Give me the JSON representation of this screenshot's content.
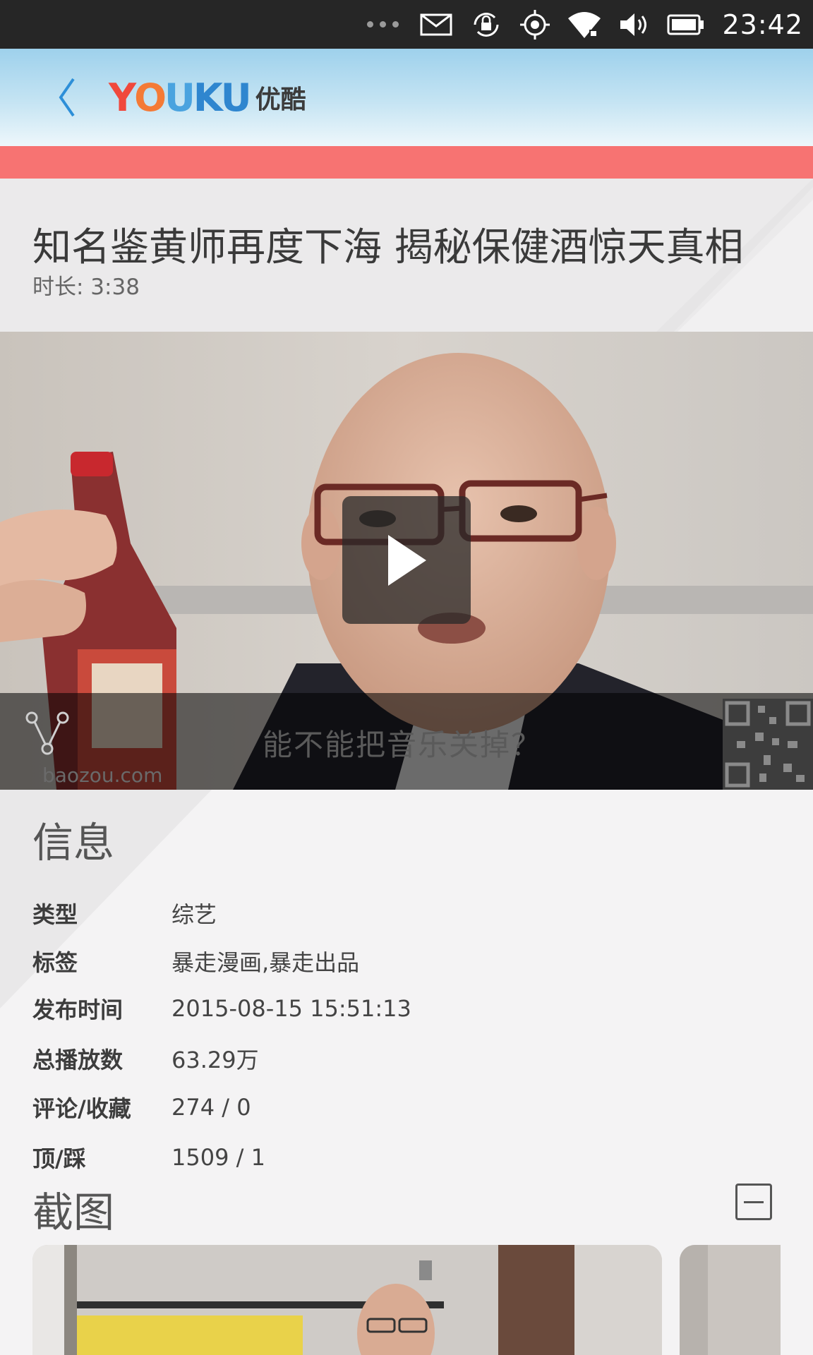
{
  "status_bar": {
    "time": "23:42",
    "icons": [
      "more-dots-icon",
      "mail-icon",
      "rotation-lock-icon",
      "location-icon",
      "wifi-icon",
      "volume-icon",
      "battery-icon"
    ]
  },
  "header": {
    "logo_en": "YOUKU",
    "logo_cn": "优酷"
  },
  "video": {
    "title": "知名鉴黄师再度下海 揭秘保健酒惊天真相",
    "duration": "时长: 3:38",
    "subtitle": "能不能把音乐关掉？",
    "watermark": "baozou.com"
  },
  "info": {
    "heading": "信息",
    "rows": [
      {
        "label": "类型",
        "value": "综艺"
      },
      {
        "label": "标签",
        "value": "暴走漫画,暴走出品"
      },
      {
        "label": "发布时间",
        "value": "2015-08-15 15:51:13"
      },
      {
        "label": "总播放数",
        "value": "63.29万"
      },
      {
        "label": "评论/收藏",
        "value": "274 / 0"
      },
      {
        "label": "顶/踩",
        "value": "1509 / 1"
      }
    ]
  },
  "screenshots": {
    "heading": "截图"
  },
  "colors": {
    "accent": "#f77372",
    "status_bar": "#262626",
    "header_top": "#9ed1ec"
  }
}
